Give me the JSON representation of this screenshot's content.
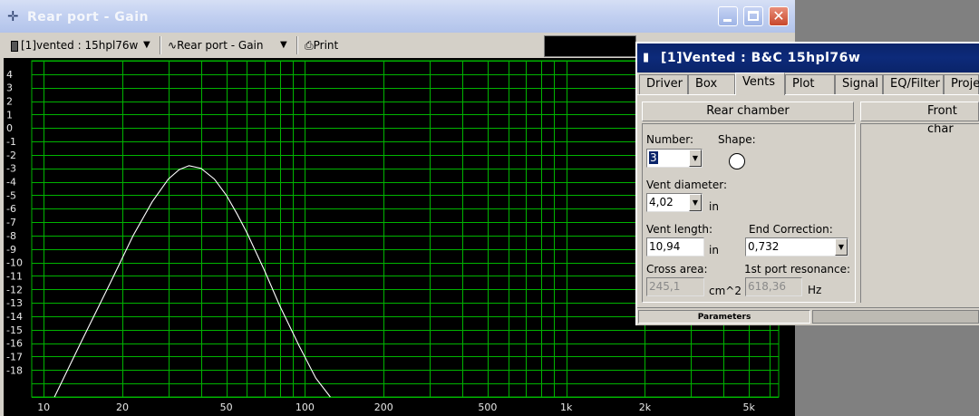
{
  "main_window": {
    "title": "Rear port - Gain",
    "toolbar": {
      "project_selector": "[1]vented : 15hpl76w",
      "plot_selector": "Rear port - Gain",
      "print_label": "Print"
    },
    "plot": {
      "y_ticks": [
        "4",
        "3",
        "2",
        "1",
        "0",
        "-1",
        "-2",
        "-3",
        "-4",
        "-5",
        "-6",
        "-7",
        "-8",
        "-9",
        "-10",
        "-11",
        "-12",
        "-13",
        "-14",
        "-15",
        "-16",
        "-17",
        "-18"
      ],
      "x_ticks": [
        "10",
        "20",
        "50",
        "100",
        "200",
        "500",
        "1k",
        "2k",
        "5k"
      ]
    }
  },
  "chart_data": {
    "type": "line",
    "xscale": "log",
    "xlim": [
      9,
      6500
    ],
    "ylim": [
      -20,
      5
    ],
    "grid": true,
    "x_tick_labels": [
      "10",
      "20",
      "50",
      "100",
      "200",
      "500",
      "1k",
      "2k",
      "5k"
    ],
    "y_tick_labels": [
      "4",
      "3",
      "2",
      "1",
      "0",
      "-1",
      "-2",
      "-3",
      "-4",
      "-5",
      "-6",
      "-7",
      "-8",
      "-9",
      "-10",
      "-11",
      "-12",
      "-13",
      "-14",
      "-15",
      "-16",
      "-17",
      "-18"
    ],
    "series": [
      {
        "color": "#ffffff",
        "x": [
          11,
          14,
          18,
          22,
          26,
          30,
          33,
          36,
          40,
          45,
          50,
          55,
          60,
          70,
          80,
          95,
          110,
          125
        ],
        "y": [
          -20,
          -15.8,
          -11.5,
          -8.0,
          -5.5,
          -3.8,
          -3.1,
          -2.8,
          -3.0,
          -3.8,
          -5.0,
          -6.4,
          -7.8,
          -10.6,
          -13.2,
          -16.2,
          -18.6,
          -20
        ]
      }
    ]
  },
  "vent_window": {
    "title": "[1]Vented : B&C 15hpl76w",
    "tabs": [
      "Driver",
      "Box",
      "Vents",
      "Plot",
      "Signal",
      "EQ/Filter",
      "Proje"
    ],
    "active_tab": "Vents",
    "rear_chamber_label": "Rear chamber",
    "front_chamber_label": "Front char",
    "number_label": "Number:",
    "number_value": "3",
    "shape_label": "Shape:",
    "vent_diameter_label": "Vent diameter:",
    "vent_diameter_value": "4,02",
    "vent_diameter_unit": "in",
    "vent_length_label": "Vent length:",
    "vent_length_value": "10,94",
    "vent_length_unit": "in",
    "end_correction_label": "End Correction:",
    "end_correction_value": "0,732",
    "cross_area_label": "Cross area:",
    "cross_area_value": "245,1",
    "cross_area_unit": "cm^2",
    "port_resonance_label": "1st port resonance:",
    "port_resonance_value": "618,36",
    "port_resonance_unit": "Hz",
    "status_label": "Parameters"
  }
}
